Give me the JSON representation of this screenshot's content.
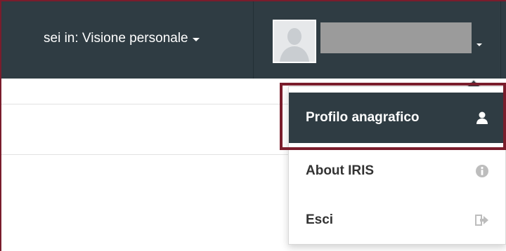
{
  "header": {
    "context_label": "sei in: Visione personale"
  },
  "user_menu": {
    "items": [
      {
        "label": "Profilo anagrafico",
        "icon": "user-icon"
      },
      {
        "label": "About IRIS",
        "icon": "info-icon"
      },
      {
        "label": "Esci",
        "icon": "sign-out-icon"
      }
    ]
  },
  "colors": {
    "navbar": "#2f3c43",
    "highlight": "#7a1d2c",
    "active_item": "#2f3c43"
  }
}
